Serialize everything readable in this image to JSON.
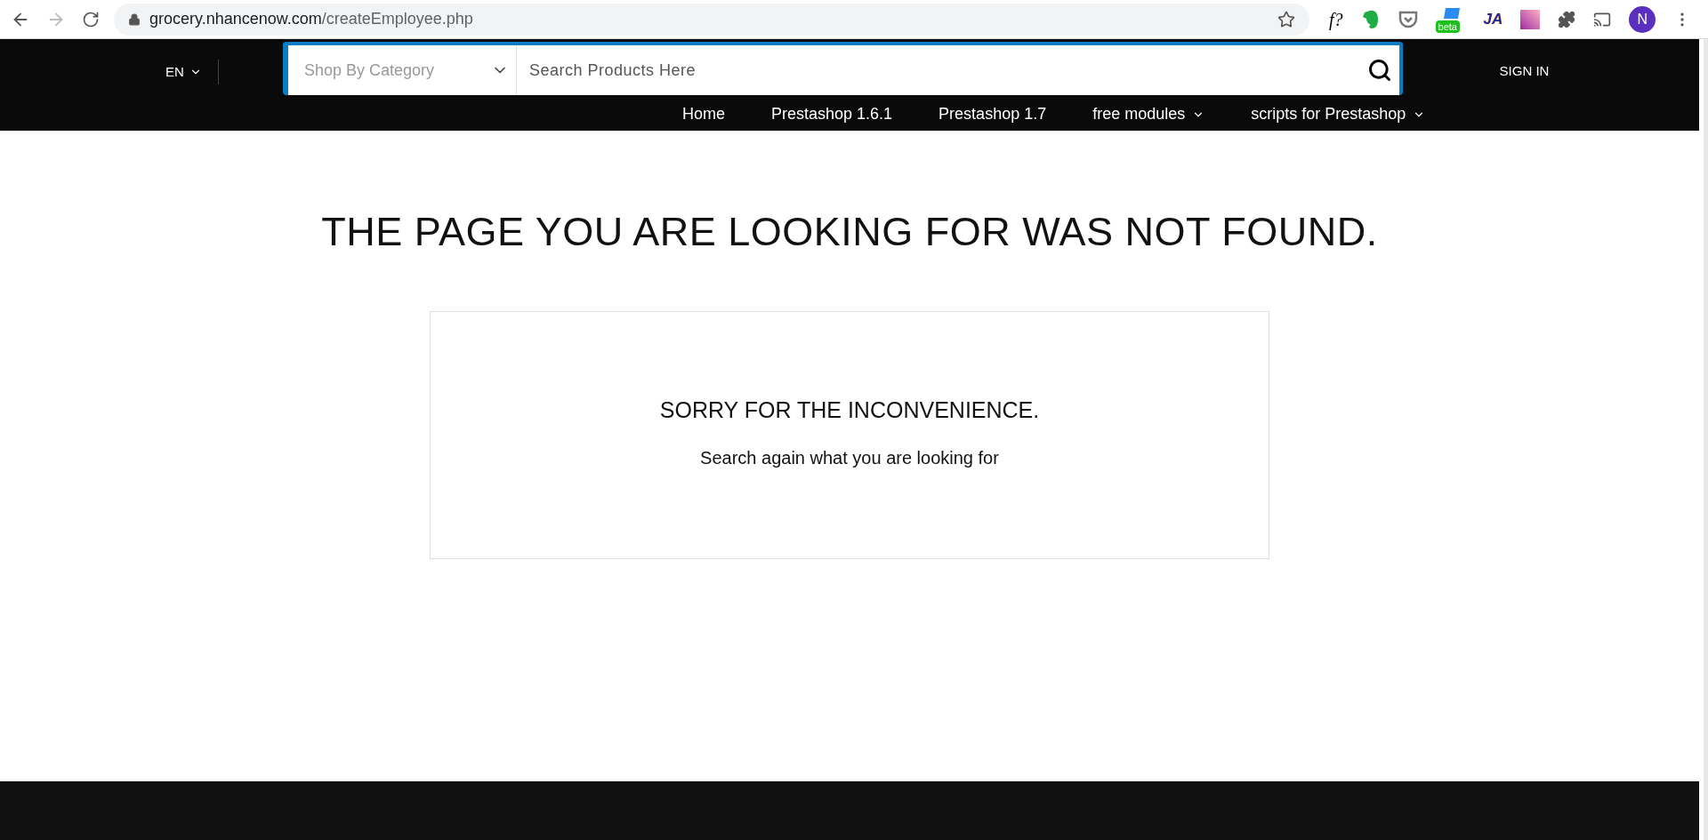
{
  "browser": {
    "url_host": "grocery.nhancenow.com",
    "url_path": "/createEmployee.php",
    "extensions": [
      {
        "kind": "formula",
        "text": "f?"
      },
      {
        "kind": "evernote"
      },
      {
        "kind": "pocket"
      },
      {
        "kind": "beta",
        "text": "beta"
      },
      {
        "kind": "ja",
        "text": "JA"
      },
      {
        "kind": "gradient"
      },
      {
        "kind": "puzzle"
      },
      {
        "kind": "cast"
      }
    ],
    "profile": "N"
  },
  "header": {
    "language": "EN",
    "category_select": "Shop By Category",
    "search": {
      "placeholder": "Search Products Here"
    },
    "sign_in": "SIGN IN",
    "nav": [
      {
        "label": "Home",
        "dropdown": false
      },
      {
        "label": "Prestashop 1.6.1",
        "dropdown": false
      },
      {
        "label": "Prestashop 1.7",
        "dropdown": false
      },
      {
        "label": "free modules",
        "dropdown": true
      },
      {
        "label": "scripts for Prestashop",
        "dropdown": true
      }
    ]
  },
  "main": {
    "title": "THE PAGE YOU ARE LOOKING FOR WAS NOT FOUND.",
    "card": {
      "heading": "SORRY FOR THE INCONVENIENCE.",
      "text": "Search again what you are looking for"
    }
  }
}
